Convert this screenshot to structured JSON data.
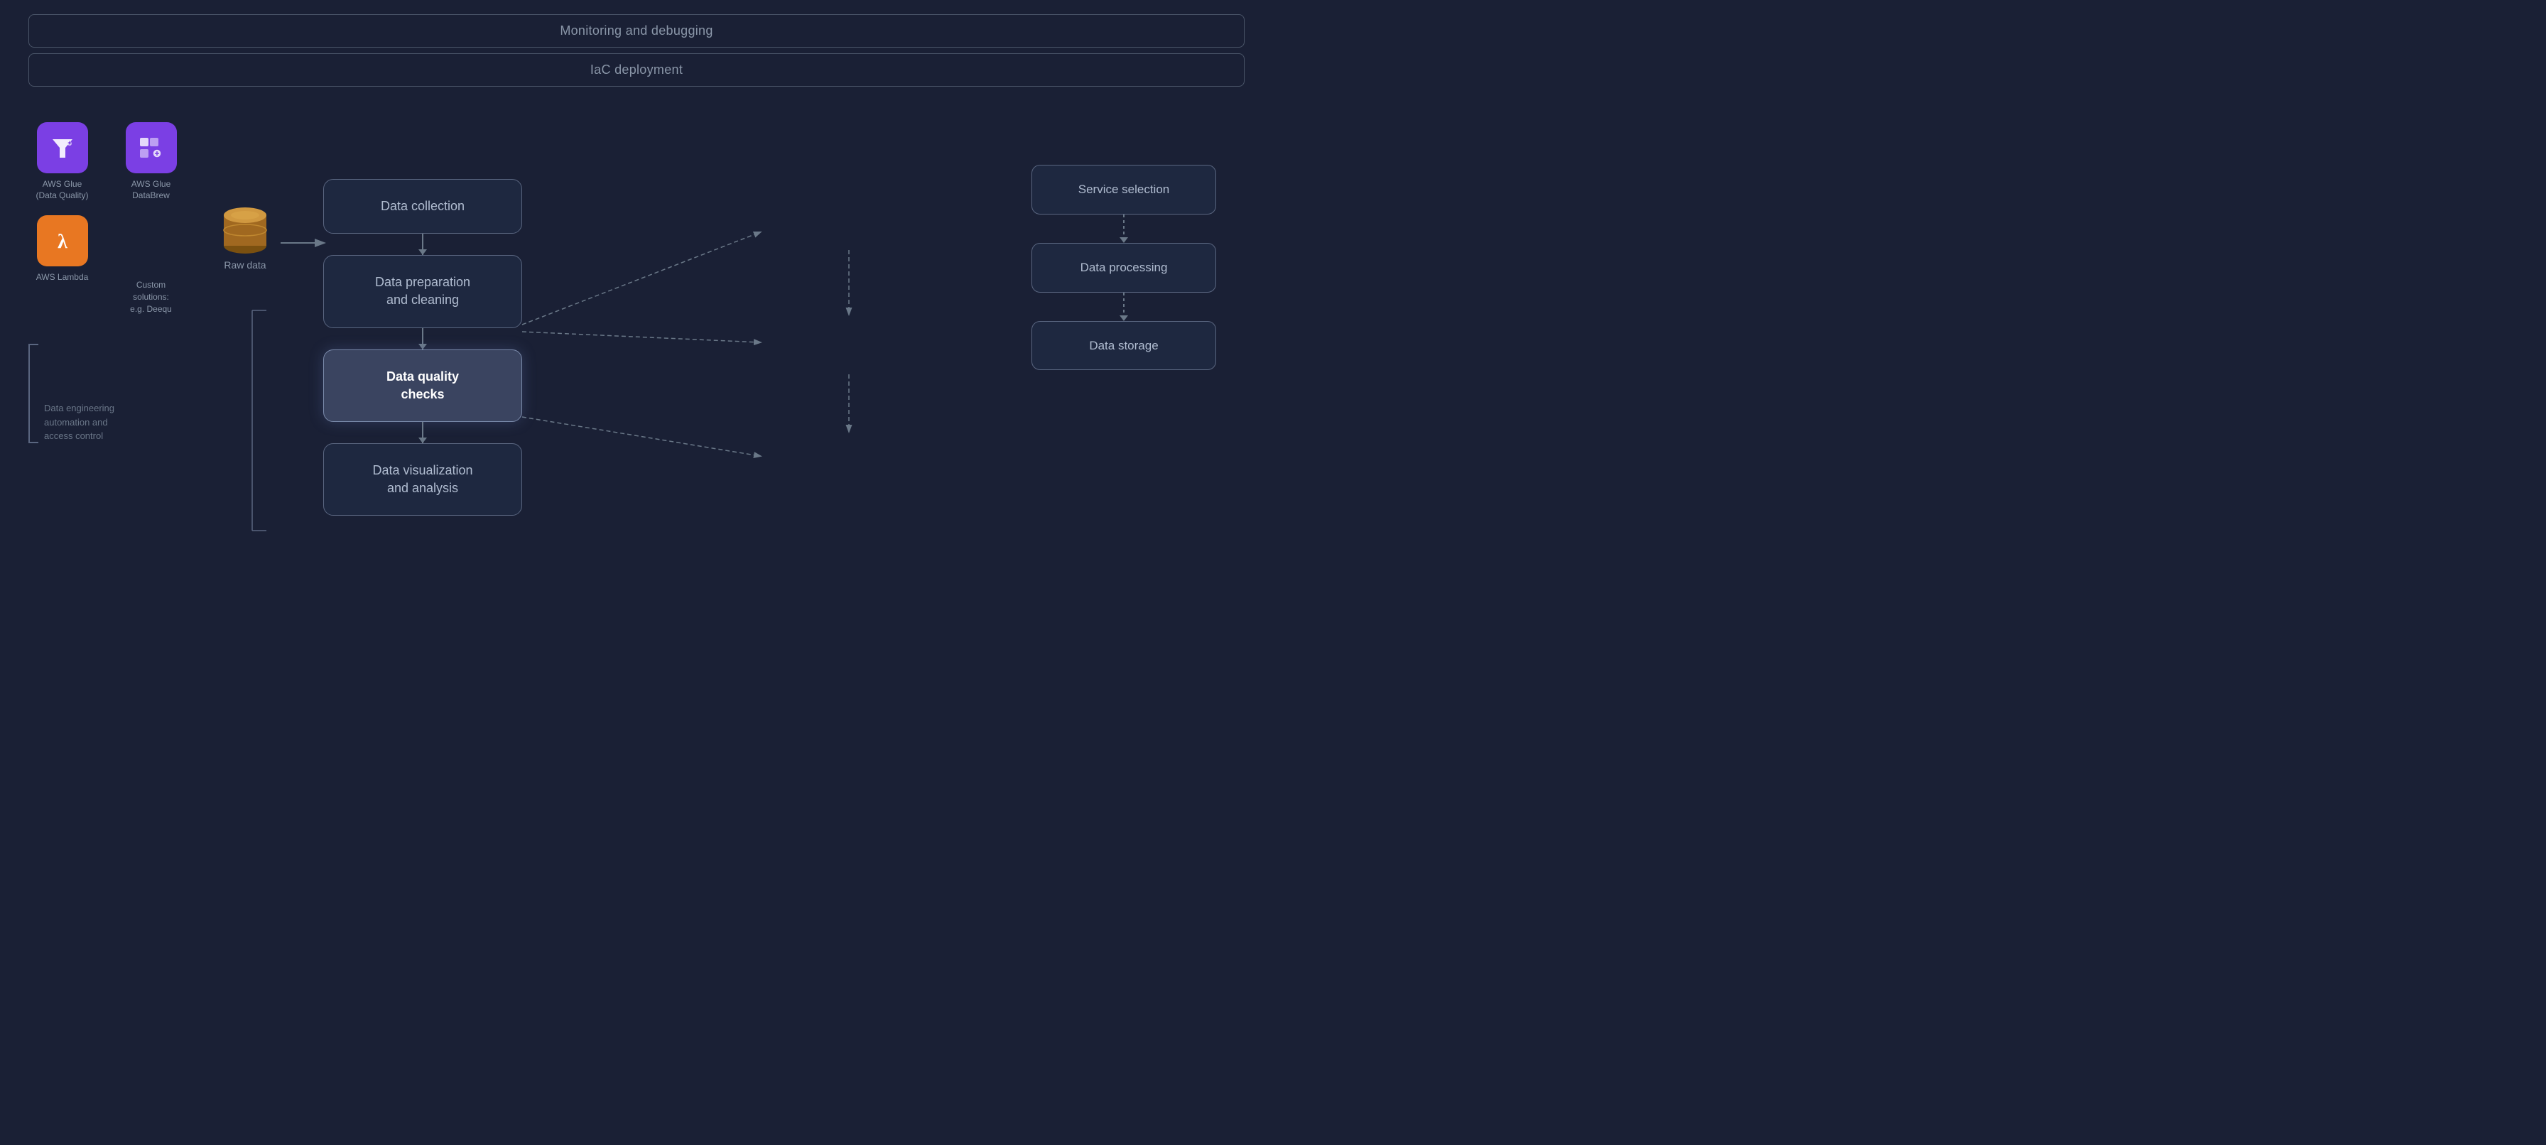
{
  "banners": {
    "monitoring": "Monitoring and debugging",
    "iac": "IaC deployment"
  },
  "services": [
    {
      "id": "aws-glue-dq",
      "label": "AWS Glue\n(Data Quality)",
      "icon_type": "purple",
      "icon": "glue-dq"
    },
    {
      "id": "aws-glue-databrew",
      "label": "AWS Glue\nDataBrew",
      "icon_type": "purple",
      "icon": "databrew"
    },
    {
      "id": "aws-lambda",
      "label": "AWS Lambda",
      "icon_type": "orange",
      "icon": "lambda"
    },
    {
      "id": "custom-solutions",
      "label": "Custom solutions:\ne.g. Deequ",
      "icon_type": "none",
      "icon": ""
    }
  ],
  "automation_label": "Data engineering\nautomation and\naccess control",
  "raw_data_label": "Raw data",
  "flow_boxes": [
    {
      "id": "data-collection",
      "label": "Data collection",
      "highlighted": false
    },
    {
      "id": "data-preparation",
      "label": "Data preparation\nand cleaning",
      "highlighted": false
    },
    {
      "id": "data-quality-checks",
      "label": "Data quality\nchecks",
      "highlighted": true
    },
    {
      "id": "data-visualization",
      "label": "Data visualization\nand analysis",
      "highlighted": false
    }
  ],
  "right_boxes": [
    {
      "id": "service-selection",
      "label": "Service selection"
    },
    {
      "id": "data-processing",
      "label": "Data processing"
    },
    {
      "id": "data-storage",
      "label": "Data storage"
    }
  ]
}
